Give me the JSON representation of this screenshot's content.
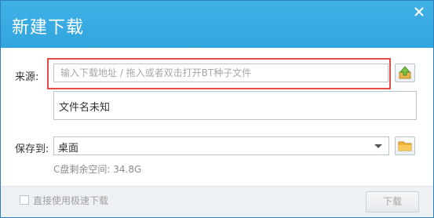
{
  "dialog": {
    "title": "新建下载"
  },
  "source": {
    "label": "来源:",
    "placeholder": "输入下载地址 / 拖入或者双击打开BT种子文件"
  },
  "filename": {
    "value": "文件名未知"
  },
  "save": {
    "label": "保存到:",
    "path": "桌面",
    "free_space": "C盘剩余空间: 34.8G"
  },
  "footer": {
    "turbo_label": "直接使用极速下载",
    "turbo_checked": false,
    "download_label": "下载"
  },
  "icons": {
    "close": "close-icon",
    "upload": "upload-icon",
    "folder": "folder-icon",
    "dropdown": "chevron-down-icon"
  },
  "colors": {
    "title_bar": "#3fb1e6",
    "highlight": "#e84a4a",
    "upload_icon": "#7bc043",
    "folder_icon": "#f2b632"
  }
}
